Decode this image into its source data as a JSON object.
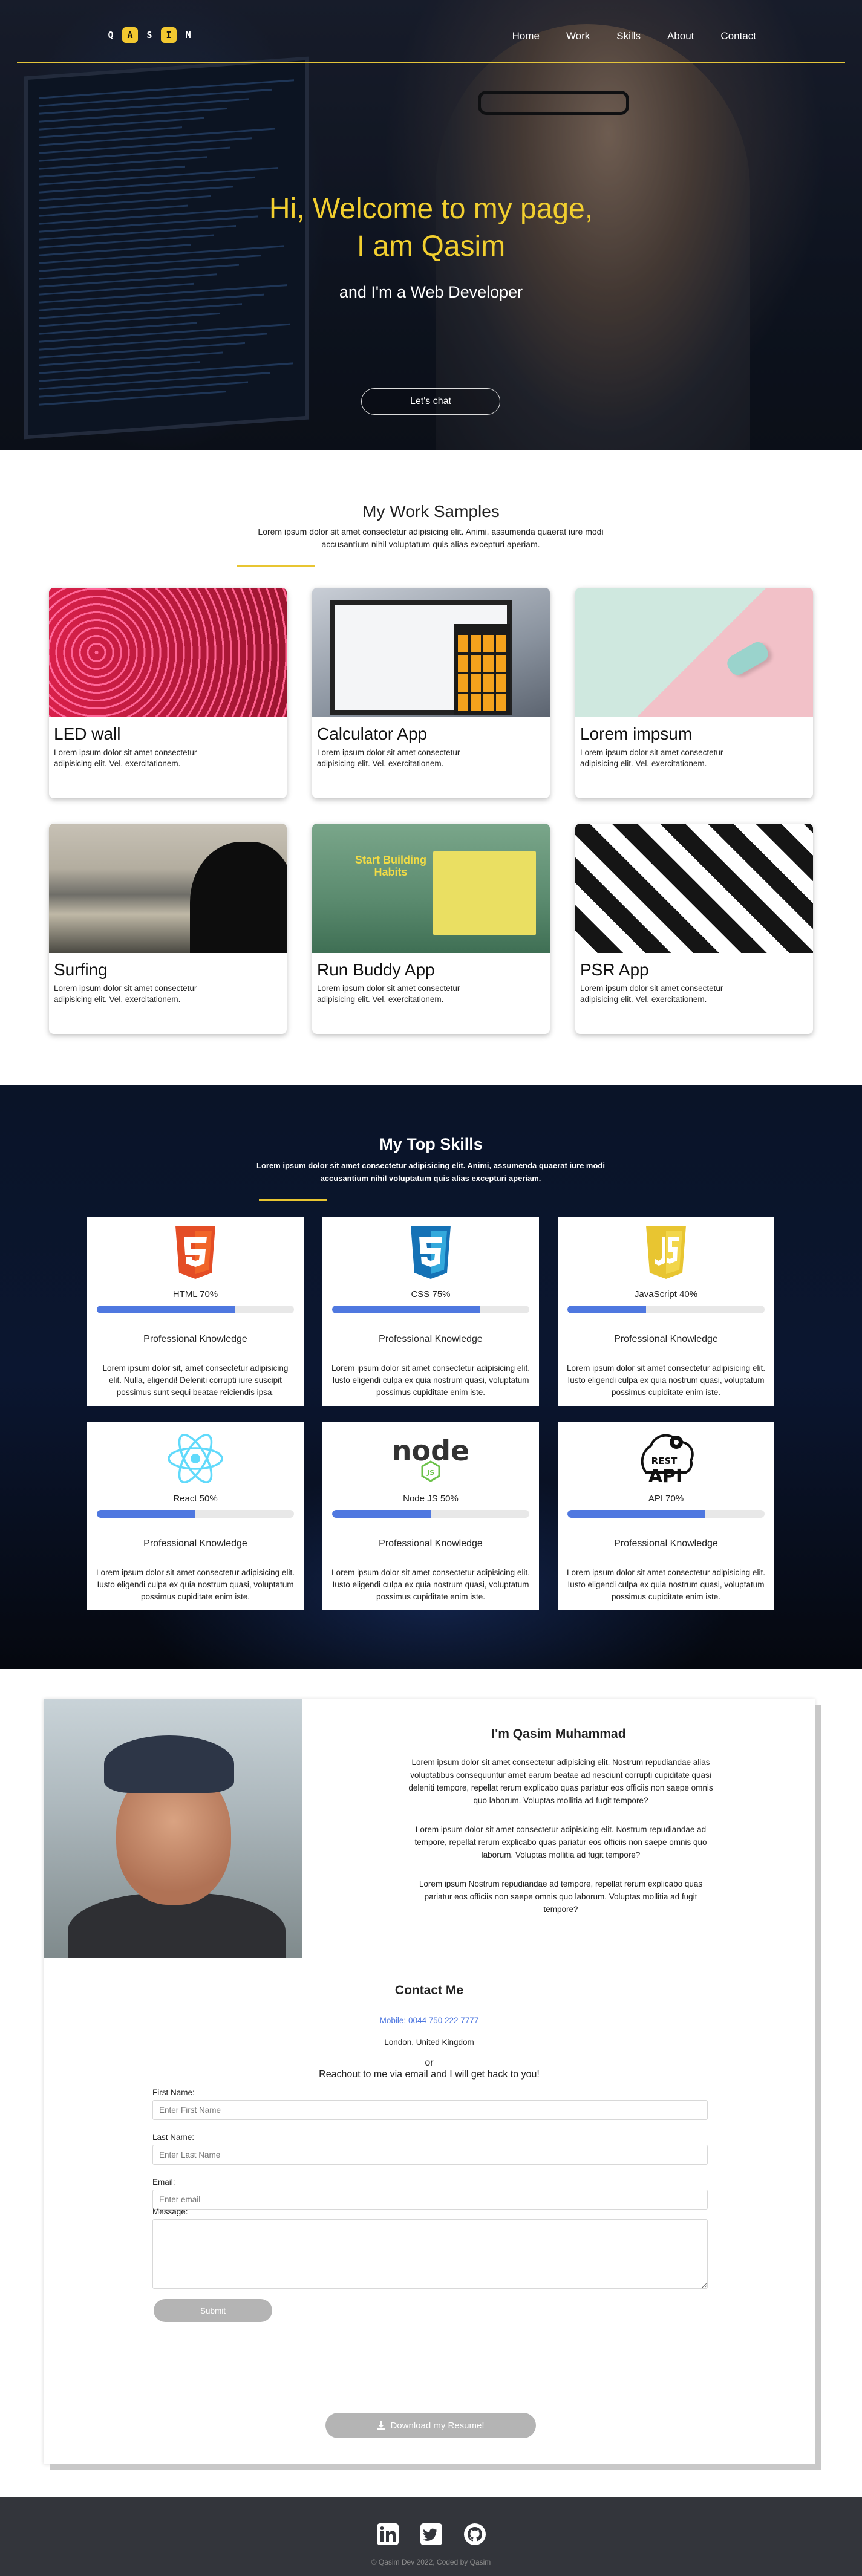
{
  "brand": {
    "letters": [
      "Q",
      "A",
      "S",
      "I",
      "M"
    ]
  },
  "nav": {
    "items": [
      "Home",
      "Work",
      "Skills",
      "About",
      "Contact"
    ]
  },
  "hero": {
    "title_line1": "Hi, Welcome to my page,",
    "title_line2": "I am Qasim",
    "subtitle": "and I'm a Web Developer",
    "cta": "Let's chat"
  },
  "work": {
    "title": "My Work Samples",
    "lead": "Lorem ipsum dolor sit amet consectetur adipisicing elit. Animi, assumenda quaerat iure modi accusantium nihil voluptatum quis alias excepturi aperiam.",
    "cards": [
      {
        "title": "LED wall",
        "text": "Lorem ipsum dolor sit amet consectetur adipisicing elit. Vel, exercitationem."
      },
      {
        "title": "Calculator App",
        "text": "Lorem ipsum dolor sit amet consectetur adipisicing elit. Vel, exercitationem."
      },
      {
        "title": "Lorem impsum",
        "text": "Lorem ipsum dolor sit amet consectetur adipisicing elit. Vel, exercitationem."
      },
      {
        "title": "Surfing",
        "text": "Lorem ipsum dolor sit amet consectetur adipisicing elit. Vel, exercitationem."
      },
      {
        "title": "Run Buddy App",
        "text": "Lorem ipsum dolor sit amet consectetur adipisicing elit. Vel, exercitationem."
      },
      {
        "title": "PSR App",
        "text": "Lorem ipsum dolor sit amet consectetur adipisicing elit. Vel, exercitationem."
      }
    ],
    "buddy_banner": "Start Building Habits"
  },
  "skills": {
    "title": "My Top Skills",
    "lead": "Lorem ipsum dolor sit amet consectetur adipisicing elit. Animi, assumenda quaerat iure modi accusantium nihil voluptatum quis alias excepturi aperiam.",
    "bar_color": "#4f78e0",
    "items": [
      {
        "icon": "html5-icon",
        "label": "HTML 70%",
        "percent": 70,
        "heading": "Professional Knowledge",
        "text": "Lorem ipsum dolor sit, amet consectetur adipisicing elit. Nulla, eligendi! Deleniti corrupti iure suscipit possimus sunt sequi beatae reiciendis ipsa."
      },
      {
        "icon": "css3-icon",
        "label": "CSS 75%",
        "percent": 75,
        "heading": "Professional Knowledge",
        "text": "Lorem ipsum dolor sit amet consectetur adipisicing elit. Iusto eligendi culpa ex quia nostrum quasi, voluptatum possimus cupiditate enim iste."
      },
      {
        "icon": "javascript-icon",
        "label": "JavaScript 40%",
        "percent": 40,
        "heading": "Professional Knowledge",
        "text": "Lorem ipsum dolor sit amet consectetur adipisicing elit. Iusto eligendi culpa ex quia nostrum quasi, voluptatum possimus cupiditate enim iste."
      },
      {
        "icon": "react-icon",
        "label": "React 50%",
        "percent": 50,
        "heading": "Professional Knowledge",
        "text": "Lorem ipsum dolor sit amet consectetur adipisicing elit. Iusto eligendi culpa ex quia nostrum quasi, voluptatum possimus cupiditate enim iste."
      },
      {
        "icon": "nodejs-icon",
        "label": "Node JS 50%",
        "percent": 50,
        "heading": "Professional Knowledge",
        "text": "Lorem ipsum dolor sit amet consectetur adipisicing elit. Iusto eligendi culpa ex quia nostrum quasi, voluptatum possimus cupiditate enim iste."
      },
      {
        "icon": "rest-api-icon",
        "label": "API 70%",
        "percent": 70,
        "heading": "Professional Knowledge",
        "text": "Lorem ipsum dolor sit amet consectetur adipisicing elit. Iusto eligendi culpa ex quia nostrum quasi, voluptatum possimus cupiditate enim iste."
      }
    ],
    "node_logo": "node",
    "node_badge": "JS",
    "api_small": "REST",
    "api_big": "API"
  },
  "about": {
    "name": "I'm Qasim Muhammad",
    "paragraphs": [
      "Lorem ipsum dolor sit amet consectetur adipisicing elit. Nostrum repudiandae alias voluptatibus consequuntur amet earum beatae ad nesciunt corrupti cupiditate quasi deleniti tempore, repellat rerum explicabo quas pariatur eos officiis non saepe omnis quo laborum. Voluptas mollitia ad fugit tempore?",
      "Lorem ipsum dolor sit amet consectetur adipisicing elit. Nostrum repudiandae ad tempore, repellat rerum explicabo quas pariatur eos officiis non saepe omnis quo laborum. Voluptas mollitia ad fugit tempore?",
      "Lorem ipsum Nostrum repudiandae ad tempore, repellat rerum explicabo quas pariatur eos officiis non saepe omnis quo laborum. Voluptas mollitia ad fugit tempore?"
    ]
  },
  "contact": {
    "title": "Contact Me",
    "mobile": "Mobile: 0044 750 222 7777",
    "city": "London, United Kingdom",
    "or": "or",
    "reach": "Reachout to me via email and I will get back to you!",
    "first_label": "First Name:",
    "first_placeholder": "Enter First Name",
    "last_label": "Last Name:",
    "last_placeholder": "Enter Last Name",
    "email_label": "Email:",
    "email_placeholder": "Enter email",
    "message_label": "Message:",
    "submit": "Submit",
    "resume": "Download my Resume!"
  },
  "footer": {
    "social": [
      "linkedin-icon",
      "twitter-icon",
      "github-icon"
    ],
    "copyright": "© Qasim Dev 2022, Coded by Qasim"
  },
  "colors": {
    "accent": "#f2cf2f",
    "progress": "#4f78e0",
    "footer": "#33353b"
  }
}
